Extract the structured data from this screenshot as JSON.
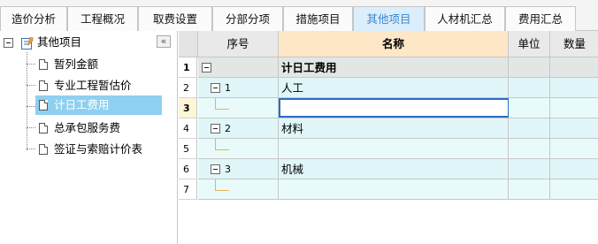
{
  "tabs": [
    {
      "label": "造价分析",
      "active": false
    },
    {
      "label": "工程概况",
      "active": false
    },
    {
      "label": "取费设置",
      "active": false
    },
    {
      "label": "分部分项",
      "active": false
    },
    {
      "label": "措施项目",
      "active": false
    },
    {
      "label": "其他项目",
      "active": true
    },
    {
      "label": "人材机汇总",
      "active": false
    },
    {
      "label": "费用汇总",
      "active": false
    }
  ],
  "tree": {
    "root_label": "其他项目",
    "collapse_label": "«",
    "items": [
      {
        "label": "暂列金额",
        "selected": false
      },
      {
        "label": "专业工程暂估价",
        "selected": false
      },
      {
        "label": "计日工费用",
        "selected": true
      },
      {
        "label": "总承包服务费",
        "selected": false
      },
      {
        "label": "签证与索赔计价表",
        "selected": false
      }
    ]
  },
  "grid": {
    "columns": {
      "seq": "序号",
      "name": "名称",
      "unit": "单位",
      "qty": "数量"
    },
    "rows": [
      {
        "rownum": "1",
        "seq": "",
        "name": "计日工费用",
        "bold": true
      },
      {
        "rownum": "2",
        "seq": "1",
        "name": "人工",
        "bold": false
      },
      {
        "rownum": "3",
        "seq": "",
        "name": "",
        "bold": false,
        "active": true
      },
      {
        "rownum": "4",
        "seq": "2",
        "name": "材料",
        "bold": false
      },
      {
        "rownum": "5",
        "seq": "",
        "name": "",
        "bold": false
      },
      {
        "rownum": "6",
        "seq": "3",
        "name": "机械",
        "bold": false
      },
      {
        "rownum": "7",
        "seq": "",
        "name": "",
        "bold": false
      }
    ]
  },
  "colors": {
    "active_tab_bg": "#dbeefc",
    "active_tab_text": "#3a86cf",
    "name_header_bg": "#fde7c7",
    "selection_bg": "#8fd0f0",
    "active_cell_border": "#2c6ec9",
    "row_bg": "#e0f6f8"
  }
}
